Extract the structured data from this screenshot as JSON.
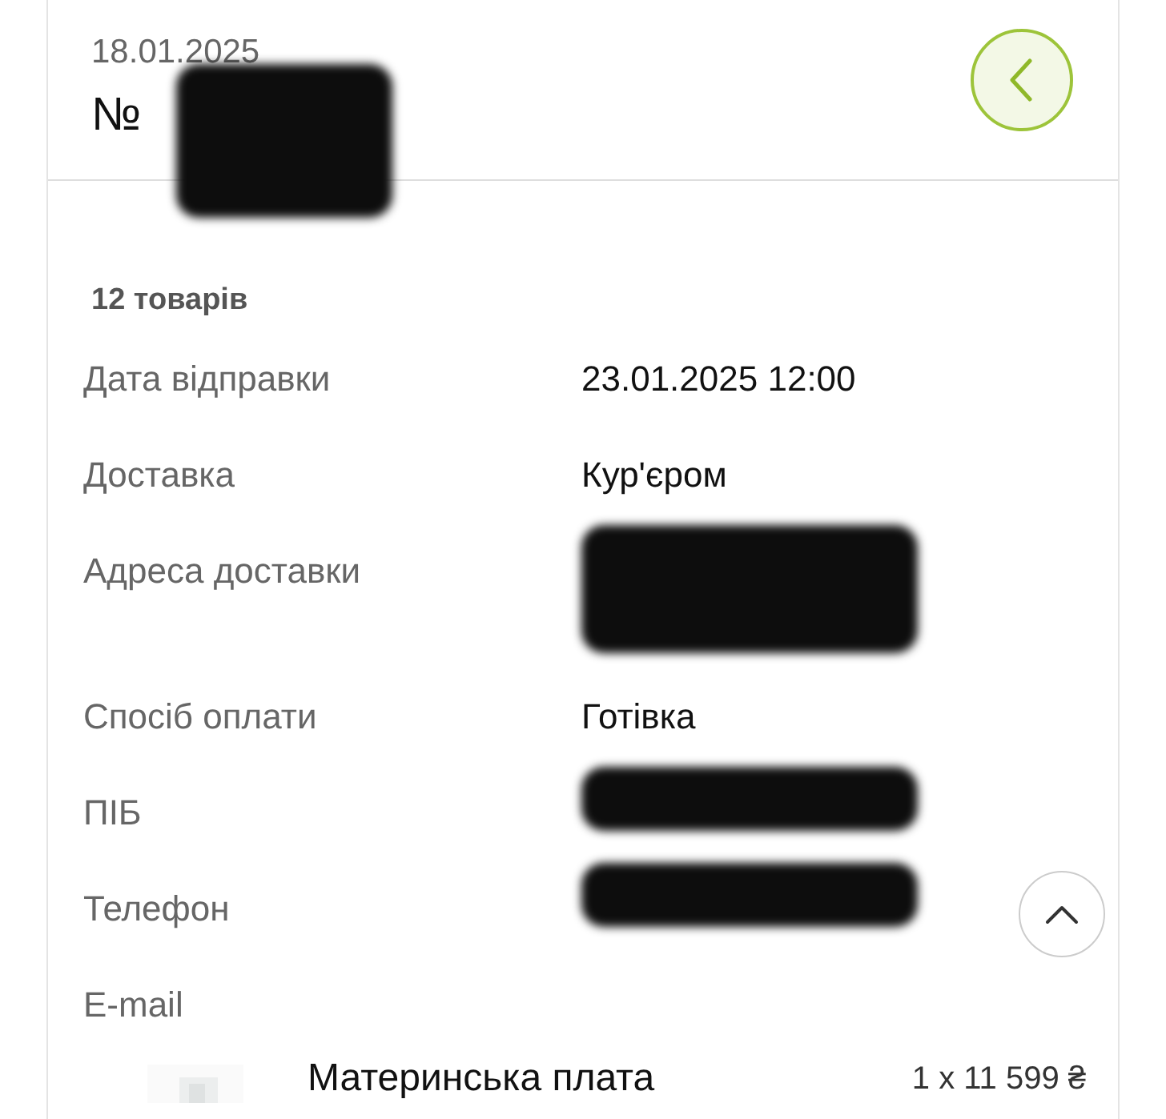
{
  "order": {
    "date": "18.01.2025",
    "number_prefix": "№",
    "number_redacted": true
  },
  "items_count": "12 товарів",
  "details": [
    {
      "label": "Дата відправки",
      "value": "23.01.2025 12:00",
      "kind": "text"
    },
    {
      "label": "Доставка",
      "value": "Кур'єром",
      "kind": "text"
    },
    {
      "label": "Адреса доставки",
      "kind": "redacted-tall"
    },
    {
      "label": "Спосіб оплати",
      "value": "Готівка",
      "kind": "text"
    },
    {
      "label": "ПІБ",
      "kind": "redacted"
    },
    {
      "label": "Телефон",
      "kind": "redacted"
    },
    {
      "label": "E-mail",
      "kind": "empty"
    }
  ],
  "product": {
    "name": "Материнська плата",
    "quantity_price": "1 x 11 599 ₴"
  }
}
